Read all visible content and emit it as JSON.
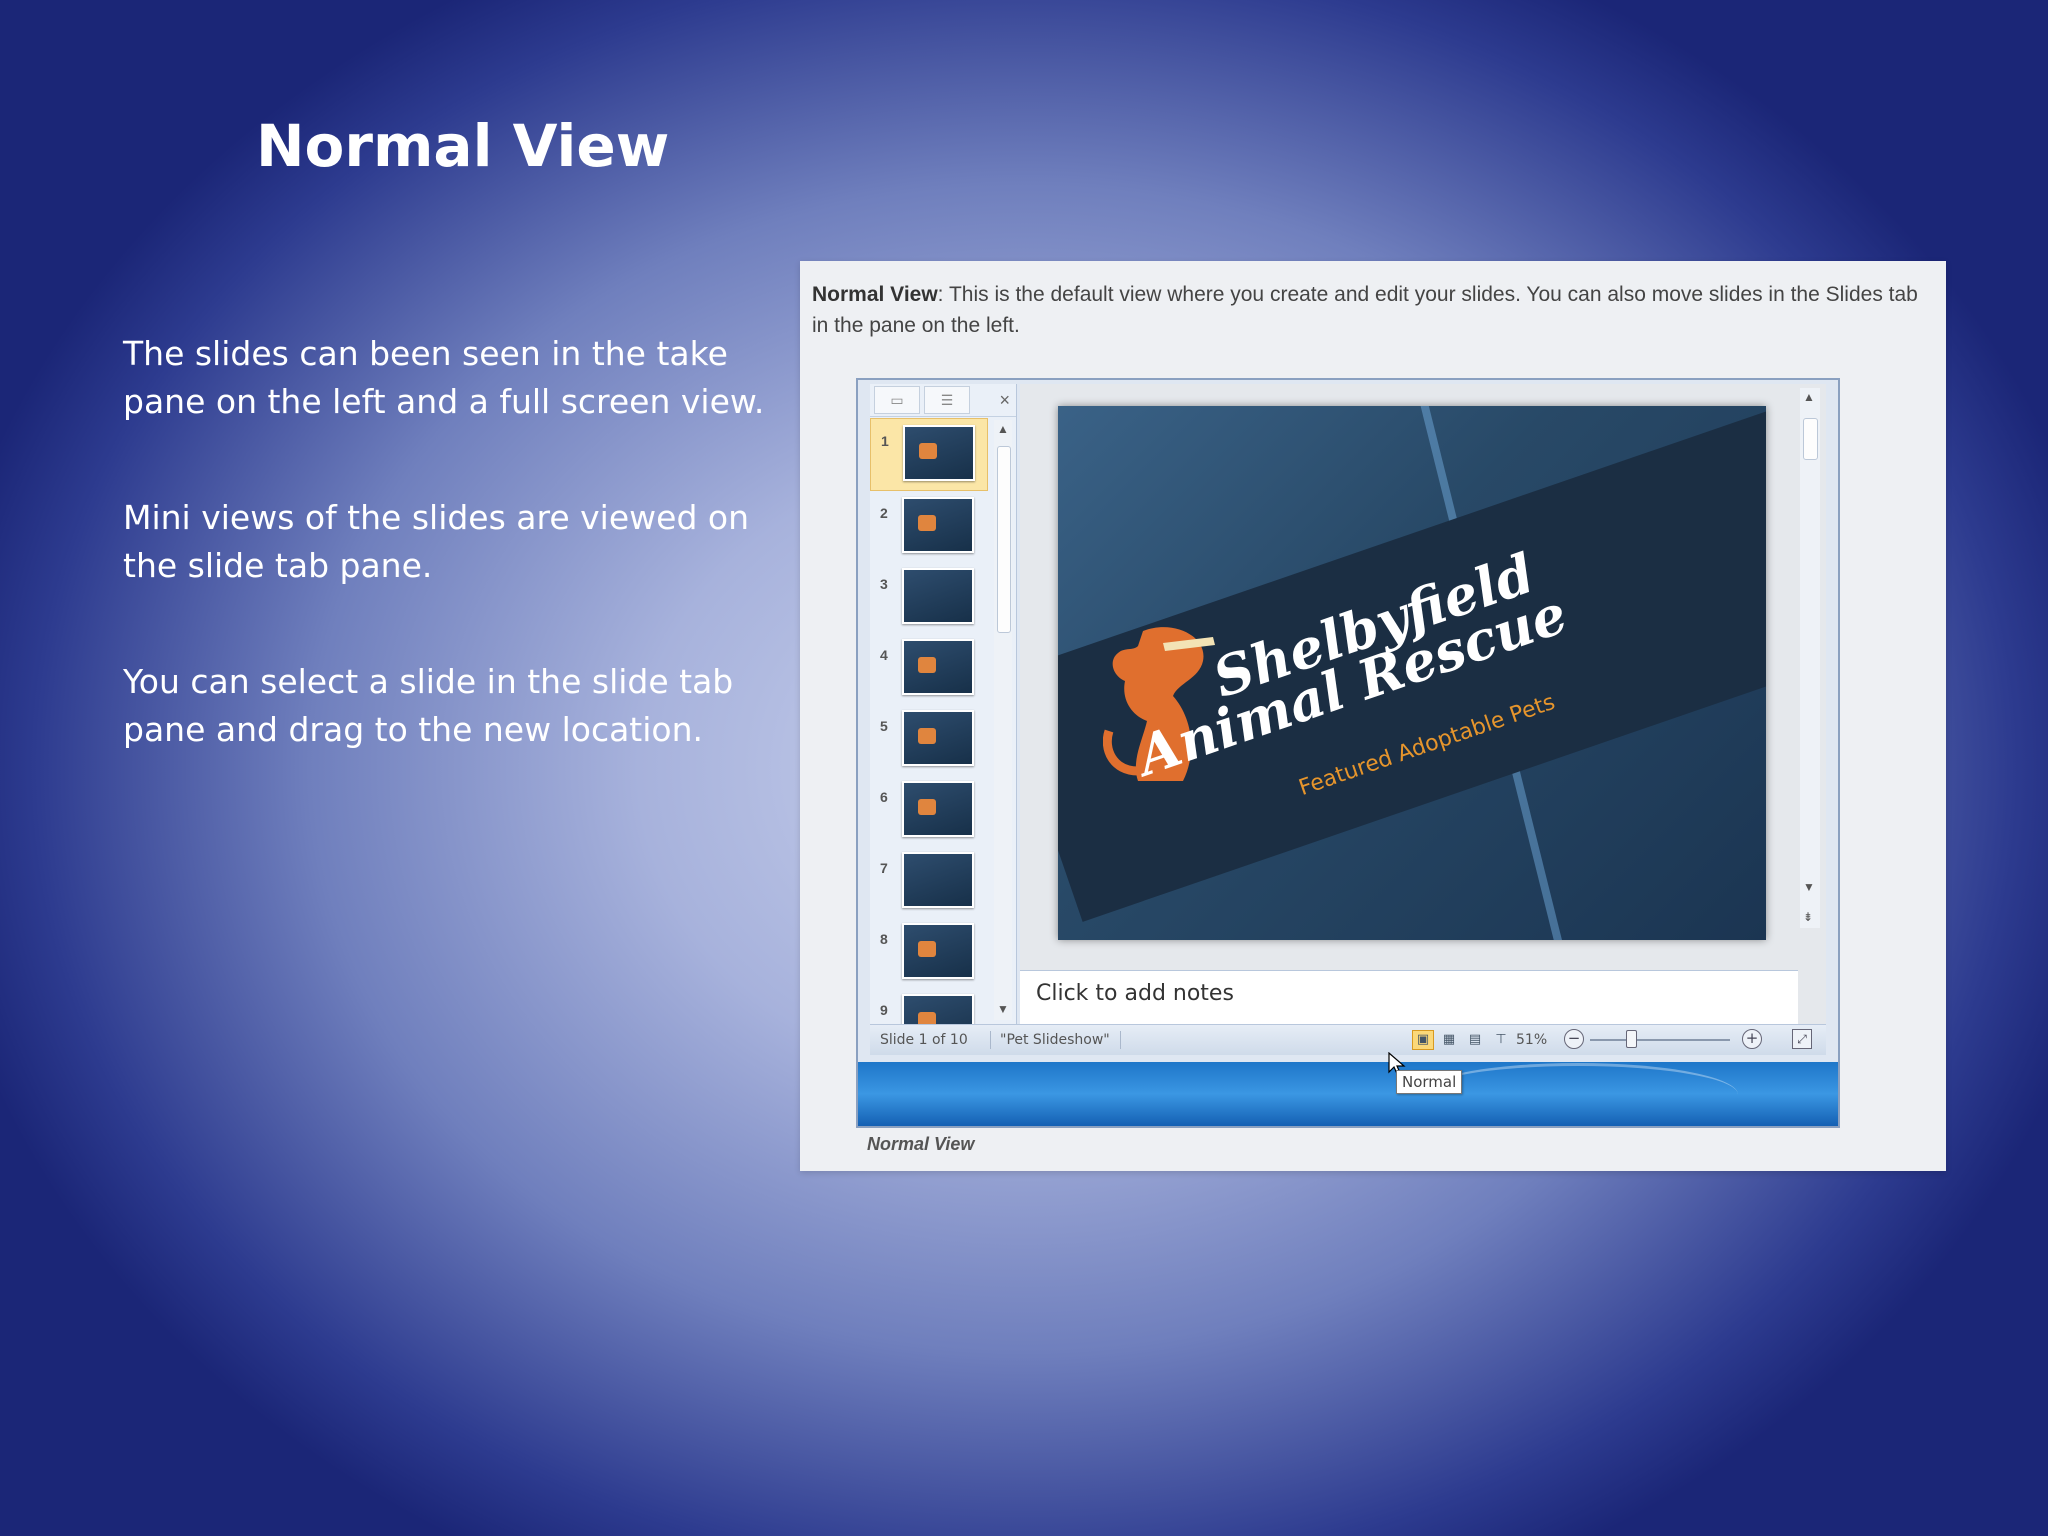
{
  "slide": {
    "title": "Normal View",
    "bullets": [
      "The slides can been seen in the take pane on the left and a full screen view.",
      "Mini views of the slides are viewed on the slide tab pane.",
      "You can select a slide in the slide tab pane and drag to the new location."
    ]
  },
  "screenshot": {
    "description_bold": "Normal View",
    "description_rest": ": This is the default view where you create and edit your slides. You can also move slides in the Slides tab in the pane on the left.",
    "caption": "Normal View",
    "pane": {
      "close_glyph": "×",
      "thumbnails": [
        "1",
        "2",
        "3",
        "4",
        "5",
        "6",
        "7",
        "8",
        "9"
      ],
      "selected": "1"
    },
    "main_slide": {
      "line1": "Shelbyfield",
      "line2": "Animal Rescue",
      "subtitle": "Featured Adoptable Pets"
    },
    "notes_placeholder": "Click to add notes",
    "status": {
      "slide_position": "Slide 1 of 10",
      "theme": "\"Pet Slideshow\"",
      "zoom": "51%",
      "zoom_minus": "−",
      "zoom_plus": "+"
    },
    "tooltip": "Normal",
    "colors": {
      "title_orange": "#e6952c",
      "selected_thumb": "#fbe6a7",
      "taskbar": "#1e76c9"
    }
  }
}
